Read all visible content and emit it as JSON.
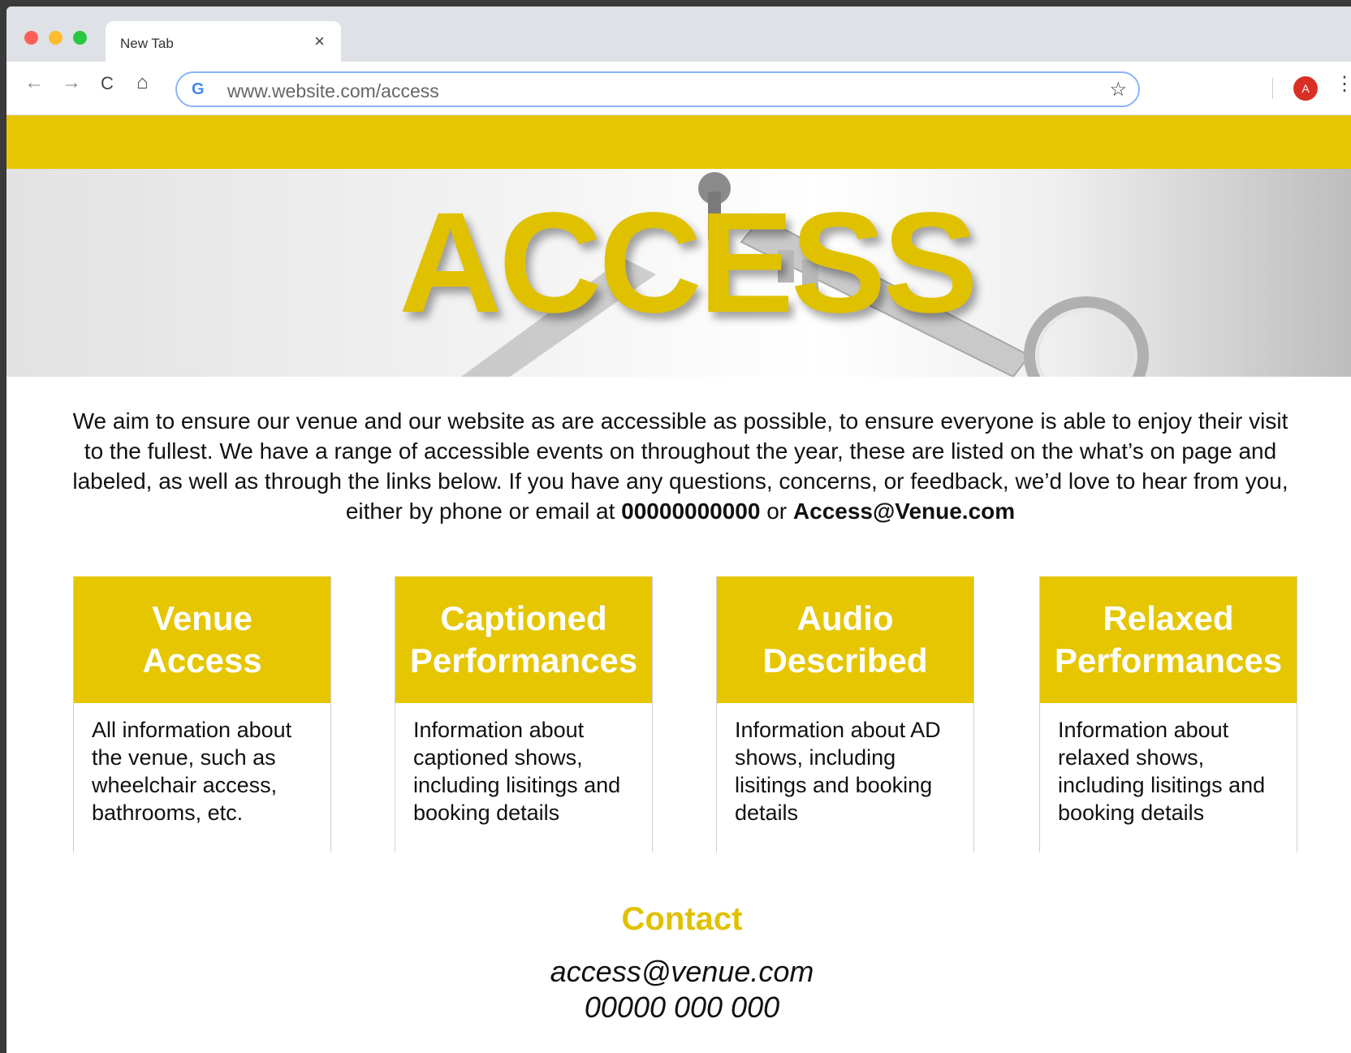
{
  "browser": {
    "tab_title": "New Tab",
    "tab_close": "×",
    "back_icon": "←",
    "forward_icon": "→",
    "reload_icon": "C",
    "home_icon": "⌂",
    "google_icon": "G",
    "url": "www.website.com/access",
    "bookmark_icon": "☆",
    "avatar_initial": "A",
    "menu_icon": "⋮"
  },
  "hero": {
    "title": "ACCESS"
  },
  "intro": {
    "text_part1": "We aim to ensure our venue and our website as are accessible as possible, to ensure everyone is able to enjoy their visit to the fullest. We have a range of accessible events on throughout the year, these are listed on the what’s on page and labeled, as well as through the links below. If you have any questions, concerns, or feedback, we’d love to hear from you, either by phone or email at ",
    "phone": "00000000000",
    "text_or": " or ",
    "email": "Access@Venue.com"
  },
  "cards": [
    {
      "title_line1": "Venue",
      "title_line2": "Access",
      "description": "All information about the venue, such as wheelchair access, bathrooms, etc."
    },
    {
      "title_line1": "Captioned",
      "title_line2": "Performances",
      "description": "Information about captioned shows, including lisitings and booking details"
    },
    {
      "title_line1": "Audio",
      "title_line2": "Described",
      "description": "Information about AD shows, including lisitings and booking details"
    },
    {
      "title_line1": "Relaxed",
      "title_line2": "Performances",
      "description": "Information about relaxed shows, including lisitings and booking  details"
    }
  ],
  "contact": {
    "title": "Contact",
    "email": "access@venue.com",
    "phone": "00000 000 000"
  },
  "colors": {
    "accent_yellow": "#e5c600",
    "frame_dark": "#3a3a3a"
  }
}
